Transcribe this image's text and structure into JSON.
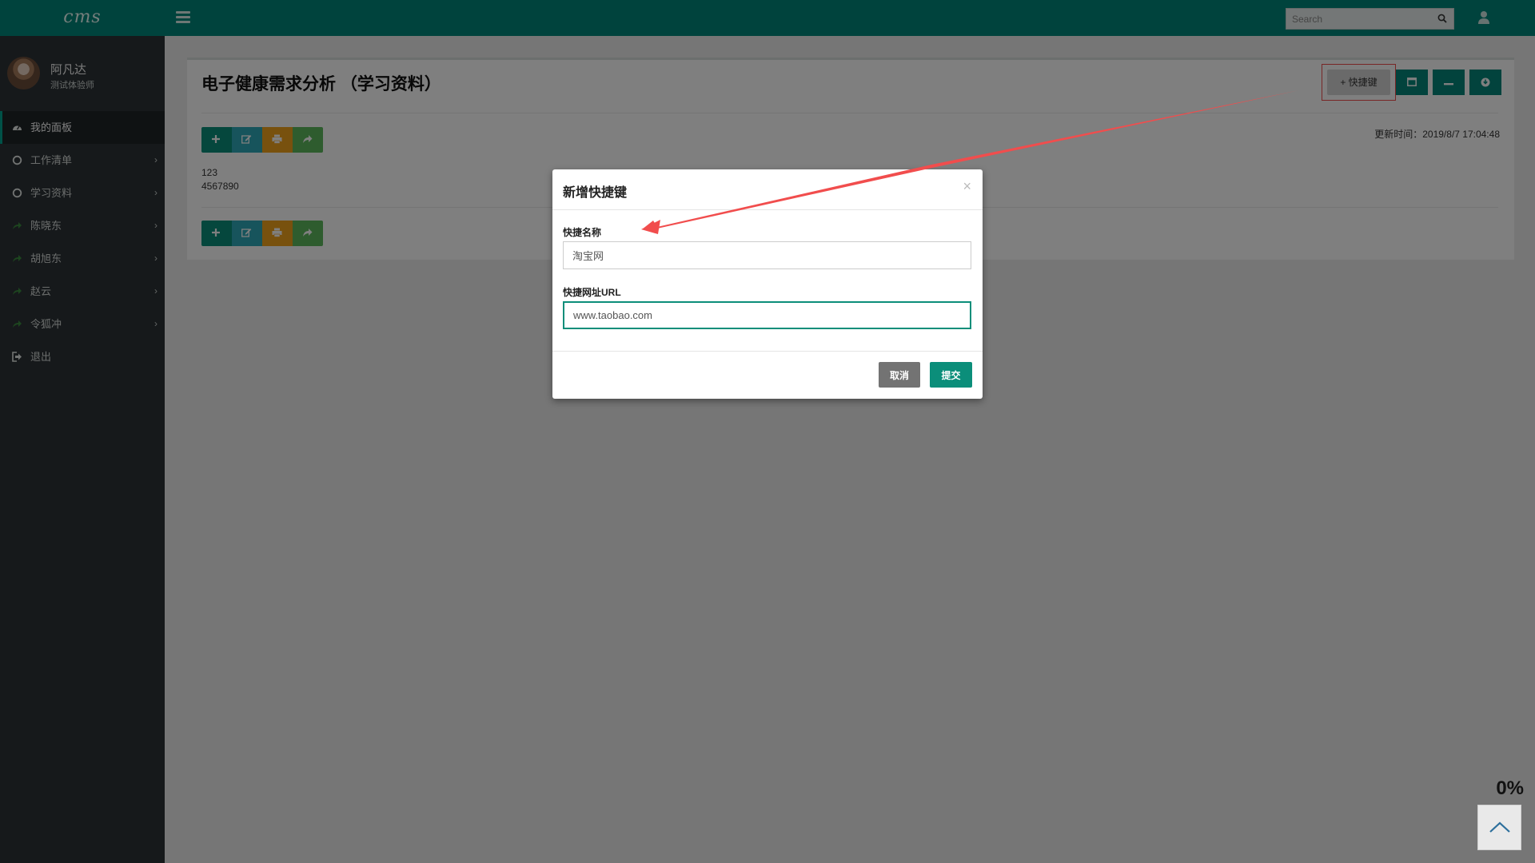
{
  "app": {
    "logo": "cms"
  },
  "search": {
    "placeholder": "Search"
  },
  "profile": {
    "name": "阿凡达",
    "role": "测试体验师"
  },
  "sidebar": {
    "items": [
      {
        "label": "我的面板",
        "icon": "dashboard-icon",
        "active": true
      },
      {
        "label": "工作清单",
        "icon": "circle-icon"
      },
      {
        "label": "学习资料",
        "icon": "circle-icon"
      },
      {
        "label": "陈晓东",
        "icon": "share-icon"
      },
      {
        "label": "胡旭东",
        "icon": "share-icon"
      },
      {
        "label": "赵云",
        "icon": "share-icon"
      },
      {
        "label": "令狐冲",
        "icon": "share-icon"
      },
      {
        "label": "退出",
        "icon": "logout-icon"
      }
    ]
  },
  "panel": {
    "title": "电子健康需求分析 （学习资料）",
    "shortcut_label": "+ 快捷键",
    "updated_label": "更新时间：",
    "updated_value": "2019/8/7 17:04:48",
    "lines": [
      "123",
      "4567890"
    ]
  },
  "modal": {
    "title": "新增快捷键",
    "close": "×",
    "name_label": "快捷名称",
    "name_value": "淘宝网",
    "url_label": "快捷网址URL",
    "url_value": "www.taobao.com",
    "cancel": "取消",
    "submit": "提交"
  },
  "progress": {
    "value": "0%"
  },
  "colors": {
    "brand": "#00877a",
    "sidebar": "#2c3236",
    "edit": "#2ea9b8",
    "print": "#f0a21d",
    "share": "#5cb85c",
    "annotation": "#f14d4d"
  }
}
